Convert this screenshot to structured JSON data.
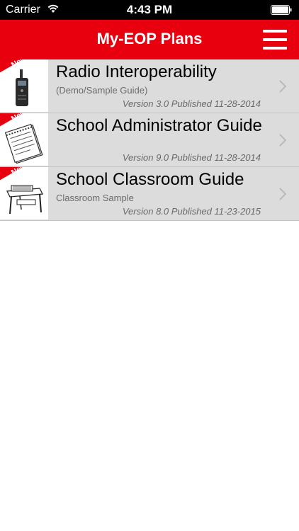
{
  "status": {
    "carrier": "Carrier",
    "time": "4:43 PM"
  },
  "header": {
    "title": "My-EOP Plans",
    "menu_icon": "hamburger-menu-icon"
  },
  "colors": {
    "accent": "#e8000f",
    "row_bg": "#dcdcdc",
    "secondary_text": "#6a6a6a"
  },
  "plans": [
    {
      "title": "Radio Interoperability",
      "subtitle": "(Demo/Sample Guide)",
      "version": "Version 3.0 Published 11-28-2014",
      "badge": "New",
      "thumbnail": "radio-icon"
    },
    {
      "title": "School Administrator Guide",
      "subtitle": "",
      "version": "Version 9.0 Published 11-28-2014",
      "badge": "New",
      "thumbnail": "notepad-icon"
    },
    {
      "title": "School Classroom Guide",
      "subtitle": "Classroom Sample",
      "version": "Version 8.0 Published 11-23-2015",
      "badge": "New",
      "thumbnail": "school-desk-icon"
    }
  ]
}
